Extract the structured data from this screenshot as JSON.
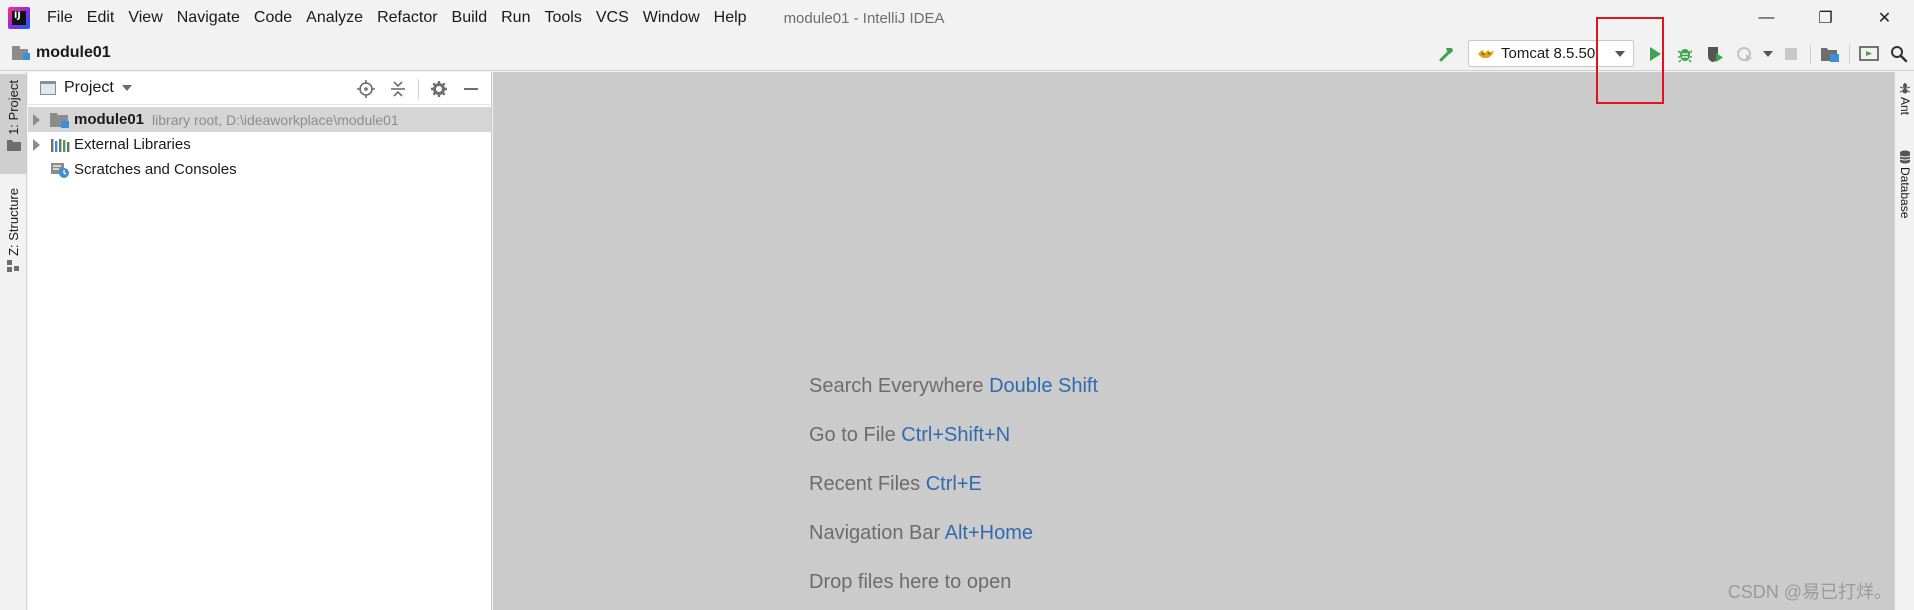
{
  "window": {
    "title": "module01 - IntelliJ IDEA",
    "logo_text": "IJ"
  },
  "menu": [
    {
      "label": "File"
    },
    {
      "label": "Edit"
    },
    {
      "label": "View"
    },
    {
      "label": "Navigate"
    },
    {
      "label": "Code"
    },
    {
      "label": "Analyze"
    },
    {
      "label": "Refactor"
    },
    {
      "label": "Build"
    },
    {
      "label": "Run"
    },
    {
      "label": "Tools"
    },
    {
      "label": "VCS"
    },
    {
      "label": "Window"
    },
    {
      "label": "Help"
    }
  ],
  "window_controls": {
    "minimize": "—",
    "restore": "❐",
    "close": "✕"
  },
  "navbar": {
    "breadcrumb": "module01",
    "run_configuration": "Tomcat 8.5.50"
  },
  "toolbar_icons": [
    "build-hammer-icon",
    "run-icon",
    "debug-icon",
    "coverage-icon",
    "profile-icon",
    "stop-icon",
    "project-structure-icon",
    "presentation-icon",
    "search-icon"
  ],
  "left_tool_tabs": [
    {
      "label": "1: Project",
      "active": true
    },
    {
      "label": "Z: Structure",
      "active": false
    }
  ],
  "right_tool_tabs": [
    {
      "label": "Ant"
    },
    {
      "label": "Database"
    }
  ],
  "project_panel": {
    "title": "Project",
    "tree": [
      {
        "label": "module01",
        "hint": "library root,  D:\\ideaworkplace\\module01",
        "expandable": true,
        "selected": true,
        "icon": "module-folder-icon"
      },
      {
        "label": "External Libraries",
        "hint": "",
        "expandable": true,
        "selected": false,
        "icon": "libraries-icon"
      },
      {
        "label": "Scratches and Consoles",
        "hint": "",
        "expandable": false,
        "selected": false,
        "icon": "scratches-icon"
      }
    ]
  },
  "editor_hints": [
    {
      "text": "Search Everywhere",
      "shortcut": "Double Shift"
    },
    {
      "text": "Go to File",
      "shortcut": "Ctrl+Shift+N"
    },
    {
      "text": "Recent Files",
      "shortcut": "Ctrl+E"
    },
    {
      "text": "Navigation Bar",
      "shortcut": "Alt+Home"
    },
    {
      "text": "Drop files here to open",
      "shortcut": ""
    }
  ],
  "watermark": "CSDN @易已打烊。",
  "colors": {
    "accent_link": "#2f6bb3",
    "run_green": "#3fa34d",
    "highlight_red": "#e0141e"
  }
}
